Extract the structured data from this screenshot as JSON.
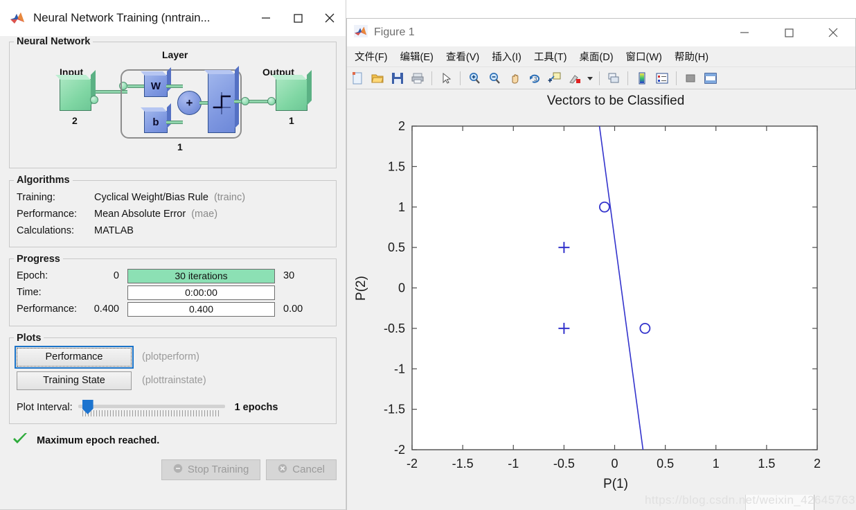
{
  "nn_dialog": {
    "title": "Neural Network Training (nntrain...",
    "app_icon": "matlab-icon",
    "window_controls": {
      "minimize": "minimize-icon",
      "maximize": "maximize-icon",
      "close": "close-icon"
    },
    "network": {
      "legend": "Neural Network",
      "input_label": "Input",
      "input_size": "2",
      "layer_label": "Layer",
      "layer_size": "1",
      "weight_label": "W",
      "bias_label": "b",
      "sum_label": "+",
      "transfer_icon": "hardlim-step-icon",
      "output_label": "Output",
      "output_size": "1"
    },
    "algorithms": {
      "legend": "Algorithms",
      "rows": [
        {
          "key": "Training:",
          "value": "Cyclical Weight/Bias Rule",
          "fn": "(trainc)"
        },
        {
          "key": "Performance:",
          "value": "Mean Absolute Error",
          "fn": "(mae)"
        },
        {
          "key": "Calculations:",
          "value": "MATLAB",
          "fn": ""
        }
      ]
    },
    "progress": {
      "legend": "Progress",
      "rows": [
        {
          "key": "Epoch:",
          "left": "0",
          "bar_text": "30 iterations",
          "right": "30",
          "fill_pct": 100,
          "filled": true
        },
        {
          "key": "Time:",
          "left": "",
          "bar_text": "0:00:00",
          "right": "",
          "fill_pct": 0,
          "filled": false
        },
        {
          "key": "Performance:",
          "left": "0.400",
          "bar_text": "0.400",
          "right": "0.00",
          "fill_pct": 0,
          "filled": false
        }
      ]
    },
    "plots": {
      "legend": "Plots",
      "buttons": [
        {
          "label": "Performance",
          "fn": "(plotperform)",
          "focused": true
        },
        {
          "label": "Training State",
          "fn": "(plottrainstate)",
          "focused": false
        }
      ],
      "interval_label": "Plot Interval:",
      "interval_value": "1 epochs"
    },
    "status": {
      "icon": "green-check-icon",
      "text": "Maximum epoch reached."
    },
    "actions": [
      {
        "label": "Stop Training",
        "icon": "stop-icon",
        "disabled": true
      },
      {
        "label": "Cancel",
        "icon": "cancel-icon",
        "disabled": true
      }
    ],
    "colors": {
      "progress_fill": "#8ce0b4",
      "focus": "#1a73c8",
      "check": "#2eab3c"
    }
  },
  "figure_window": {
    "title": "Figure 1",
    "app_icon": "matlab-icon",
    "window_controls": {
      "minimize": "minimize-icon",
      "maximize": "maximize-icon",
      "close": "close-icon"
    },
    "menus": [
      "文件(F)",
      "编辑(E)",
      "查看(V)",
      "插入(I)",
      "工具(T)",
      "桌面(D)",
      "窗口(W)",
      "帮助(H)"
    ],
    "toolbar": [
      "new-figure-icon",
      "open-file-icon",
      "save-icon",
      "print-icon",
      "sep",
      "pointer-icon",
      "sep",
      "zoom-in-icon",
      "zoom-out-icon",
      "pan-icon",
      "rotate-3d-icon",
      "data-cursor-icon",
      "brush-icon",
      "brush-dropdown-icon",
      "sep",
      "link-plot-icon",
      "sep",
      "colorbar-icon",
      "legend-icon",
      "sep",
      "hide-plot-tools-icon",
      "show-plot-tools-icon"
    ],
    "watermark": "https://blog.csdn.net/weixin_42645763"
  },
  "chart_data": {
    "type": "scatter",
    "title": "Vectors to be Classified",
    "xlabel": "P(1)",
    "ylabel": "P(2)",
    "xlim": [
      -2,
      2
    ],
    "ylim": [
      -2,
      2
    ],
    "xticks": [
      -2,
      -1.5,
      -1,
      -0.5,
      0,
      0.5,
      1,
      1.5,
      2
    ],
    "yticks": [
      -2,
      -1.5,
      -1,
      -0.5,
      0,
      0.5,
      1,
      1.5,
      2
    ],
    "grid": false,
    "legend": null,
    "series": [
      {
        "name": "class-1-plus",
        "marker": "plus",
        "color": "#3333cc",
        "points": [
          {
            "x": -0.5,
            "y": 0.5
          },
          {
            "x": -0.5,
            "y": -0.5
          }
        ]
      },
      {
        "name": "class-0-circle",
        "marker": "circle",
        "color": "#3333cc",
        "points": [
          {
            "x": -0.1,
            "y": 1.0
          },
          {
            "x": 0.3,
            "y": -0.5
          }
        ]
      }
    ],
    "decision_boundary": {
      "name": "perceptron-decision-line",
      "color": "#3333cc",
      "x_at_ymax": -0.15,
      "x_at_ymin": 0.28
    }
  }
}
